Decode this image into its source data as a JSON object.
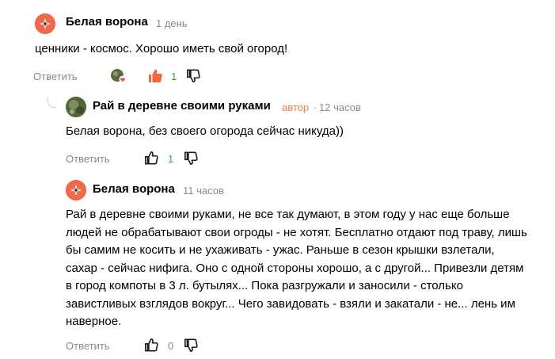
{
  "comments": [
    {
      "author": "Белая ворона",
      "time": "1 день",
      "text": "ценники - космос. Хорошо иметь свой огород!",
      "reply_label": "Ответить",
      "likes": "1"
    },
    {
      "author": "Рай в деревне своими руками",
      "badge": "автор",
      "time": "12 часов",
      "text": "Белая ворона, без своего огорода сейчас никуда))",
      "reply_label": "Ответить",
      "likes": "1"
    },
    {
      "author": "Белая ворона",
      "time": "11 часов",
      "text": "Рай в деревне своими руками, не все так думают, в этом году у нас еще больше людей не обрабатывают свои огроды - не хотят. Бесплатно отдают под траву, лишь бы самим не косить и не ухаживать - ужас. Раньше в сезон крышки взлетали, сахар - сейчас нифига. Оно с одной стороны хорошо, а с другой... Привезли детям в город компоты в 3 л. бутылях... Пока разгружали и заносили - столько завистливых взглядов вокруг... Чего завидовать - взяли и закатали - не... лень им наверное.",
      "reply_label": "Ответить",
      "likes": "0"
    }
  ],
  "colors": {
    "avatar_bg": "#ef6a4c",
    "author_badge": "#e8804a",
    "like_active": "#f0673c",
    "like_count_active": "#35a33b",
    "muted": "#8a8a8a"
  },
  "icons": [
    "crow-avatar-icon",
    "author-liked-avatar-icon",
    "thumbs-up-icon",
    "thumbs-down-icon",
    "thread-reply-line-icon"
  ]
}
